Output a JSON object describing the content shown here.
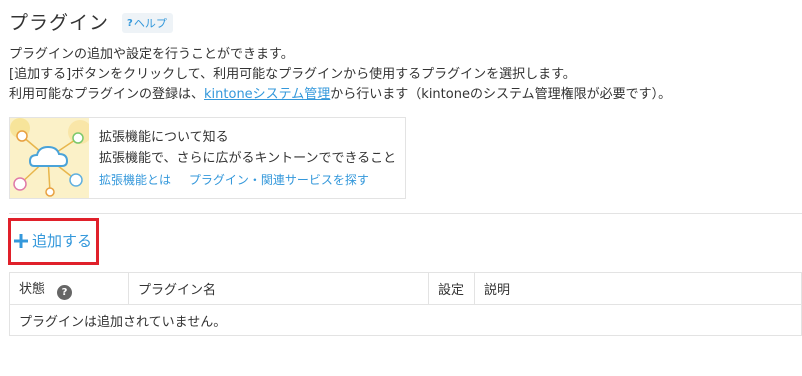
{
  "header": {
    "title": "プラグイン",
    "help_label": "ヘルプ",
    "help_icon_glyph": "?"
  },
  "description": {
    "line1": "プラグインの追加や設定を行うことができます。",
    "line2": "[追加する]ボタンをクリックして、利用可能なプラグインから使用するプラグインを選択します。",
    "line3_before": "利用可能なプラグインの登録は、",
    "line3_link": "kintoneシステム管理",
    "line3_after": "から行います（kintoneのシステム管理権限が必要です）。"
  },
  "promo": {
    "heading": "拡張機能について知る",
    "subheading": "拡張機能で、さらに広がるキントーンでできること",
    "link1": "拡張機能とは",
    "link2": "プラグイン・関連サービスを探す"
  },
  "toolbar": {
    "add_label": "追加する"
  },
  "table": {
    "columns": {
      "status": "状態",
      "status_help": "?",
      "name": "プラグイン名",
      "settings": "設定",
      "description": "説明"
    },
    "empty_message": "プラグインは追加されていません。"
  },
  "colors": {
    "link": "#3498db",
    "highlight_border": "#e0202a",
    "border": "#e3e3e3",
    "text": "#333333"
  }
}
